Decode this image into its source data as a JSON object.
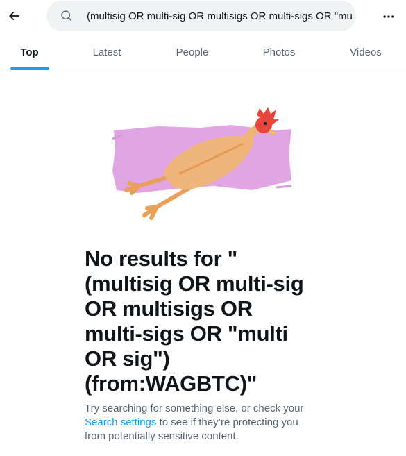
{
  "header": {
    "back_icon": "arrow-left-icon",
    "search_icon": "search-icon",
    "search_query": "(multisig OR multi-sig OR multisigs OR multi-sigs OR \"mu",
    "more_icon": "more-dots-icon"
  },
  "tabs": [
    {
      "label": "Top",
      "active": true
    },
    {
      "label": "Latest",
      "active": false
    },
    {
      "label": "People",
      "active": false
    },
    {
      "label": "Photos",
      "active": false
    },
    {
      "label": "Videos",
      "active": false
    }
  ],
  "empty_state": {
    "illustration": "rubber-chicken-illustration",
    "headline_lines": [
      "No results for \"",
      "(multisig OR multi-sig",
      "OR multisigs OR",
      "multi-sigs OR \"multi",
      "OR sig\")",
      "(from:WAGBTC)\""
    ],
    "sub_prefix": "Try searching for something else, or check your",
    "sub_link": "Search settings",
    "sub_suffix": " to see if they’re protecting you from potentially sensitive content."
  },
  "colors": {
    "accent": "#1d9bf0",
    "text_primary": "#0f1419",
    "text_secondary": "#536471",
    "search_bg": "#eff3f4",
    "illustration_bg": "#dfa6e3"
  }
}
